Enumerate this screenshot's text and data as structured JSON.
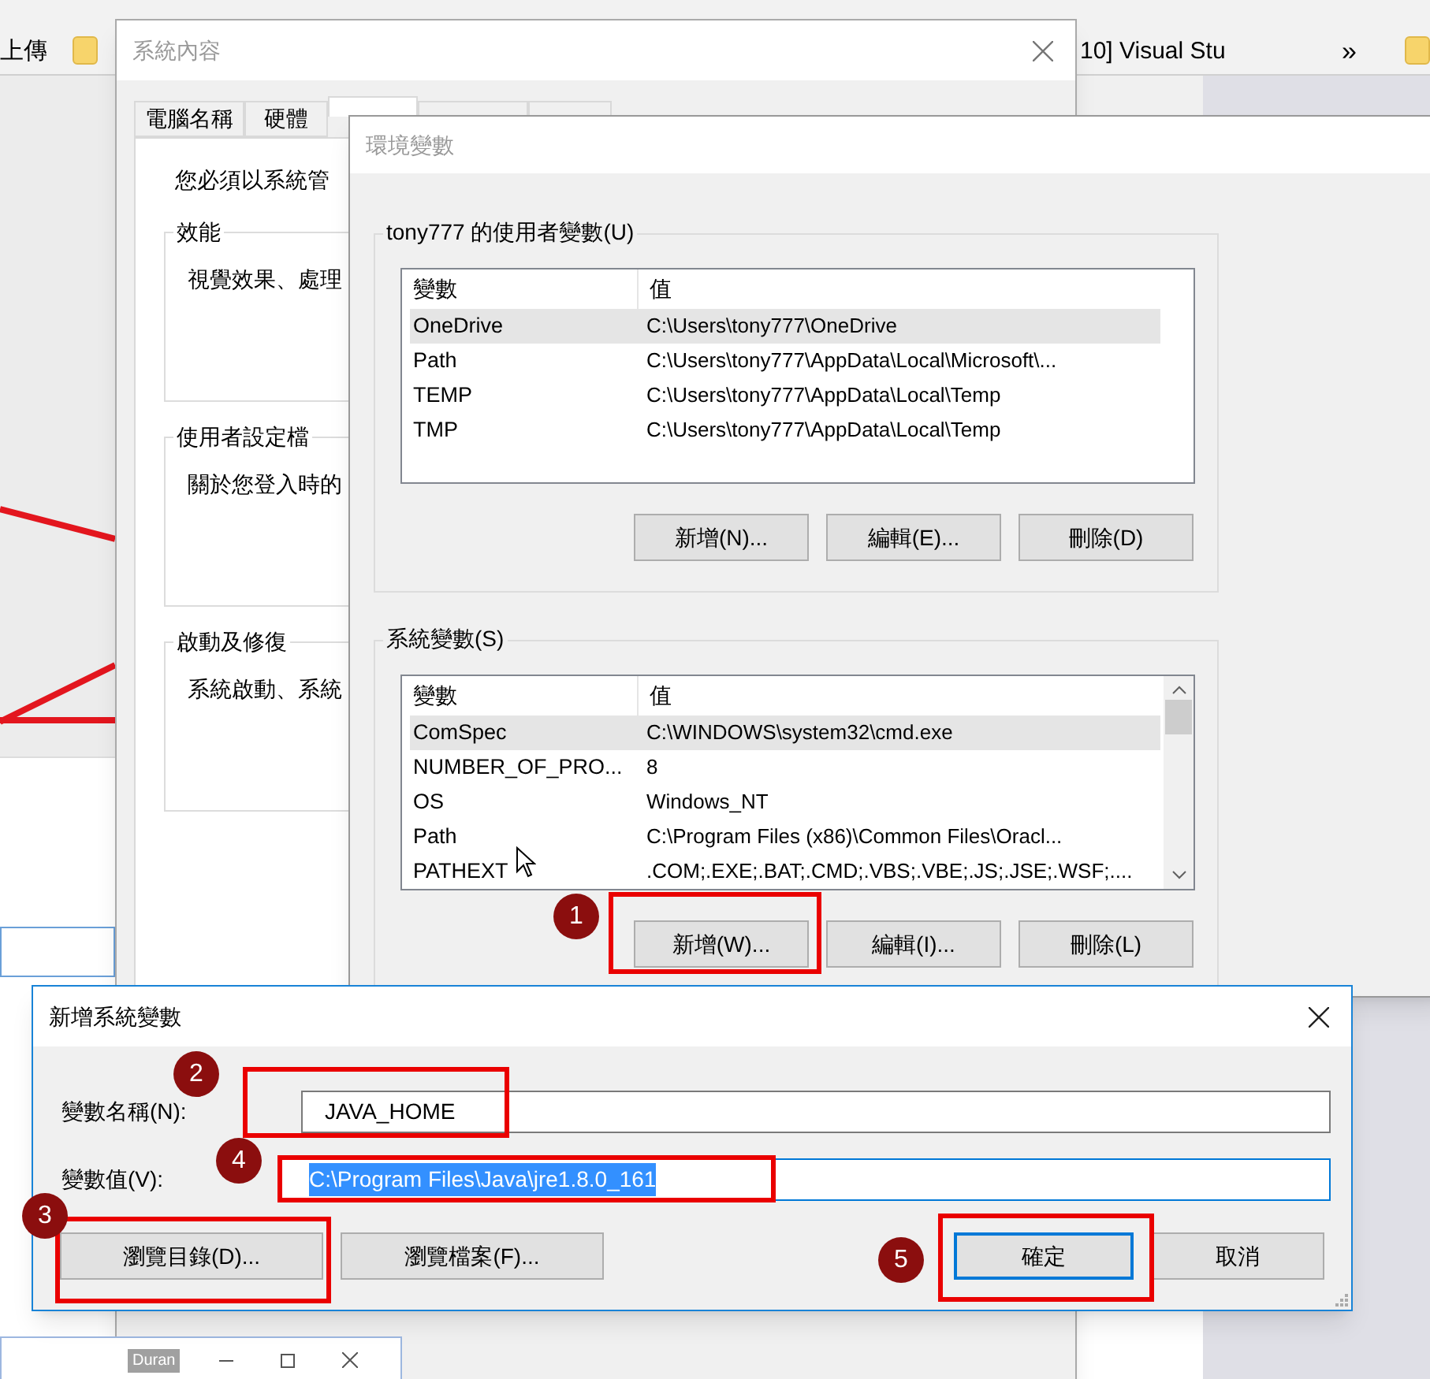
{
  "browser_bar": {
    "bookmarks": [
      {
        "label": "上傳"
      },
      {
        "label": "10] Visual Stu"
      }
    ],
    "overflow": "»"
  },
  "system_properties": {
    "title": "系統內容",
    "tabs": [
      {
        "label": "電腦名稱",
        "selected": false
      },
      {
        "label": "硬體",
        "selected": false
      },
      {
        "selected": true
      },
      {
        "selected": false
      },
      {
        "selected": false
      }
    ],
    "notice": "您必須以系統管",
    "groups": [
      {
        "title": "效能",
        "text": "視覺效果、處理"
      },
      {
        "title": "使用者設定檔",
        "text": "關於您登入時的"
      },
      {
        "title": "啟動及修復",
        "text": "系統啟動、系統"
      }
    ]
  },
  "environment_variables": {
    "title": "環境變數",
    "sections": [
      {
        "title": "tony777 的使用者變數(U)",
        "columns": [
          "變數",
          "值"
        ],
        "scrollbar": false,
        "rows": [
          {
            "name": "OneDrive",
            "value": "C:\\Users\\tony777\\OneDrive",
            "selected": true
          },
          {
            "name": "Path",
            "value": "C:\\Users\\tony777\\AppData\\Local\\Microsoft\\...",
            "selected": false
          },
          {
            "name": "TEMP",
            "value": "C:\\Users\\tony777\\AppData\\Local\\Temp",
            "selected": false
          },
          {
            "name": "TMP",
            "value": "C:\\Users\\tony777\\AppData\\Local\\Temp",
            "selected": false
          }
        ],
        "buttons": [
          "新增(N)...",
          "編輯(E)...",
          "刪除(D)"
        ]
      },
      {
        "title": "系統變數(S)",
        "columns": [
          "變數",
          "值"
        ],
        "scrollbar": true,
        "rows": [
          {
            "name": "ComSpec",
            "value": "C:\\WINDOWS\\system32\\cmd.exe",
            "selected": true
          },
          {
            "name": "NUMBER_OF_PRO...",
            "value": "8",
            "selected": false
          },
          {
            "name": "OS",
            "value": "Windows_NT",
            "selected": false
          },
          {
            "name": "Path",
            "value": "C:\\Program Files (x86)\\Common Files\\Oracl...",
            "selected": false
          },
          {
            "name": "PATHEXT",
            "value": ".COM;.EXE;.BAT;.CMD;.VBS;.VBE;.JS;.JSE;.WSF;....",
            "selected": false
          }
        ],
        "buttons": [
          "新增(W)...",
          "編輯(I)...",
          "刪除(L)"
        ]
      }
    ]
  },
  "new_variable_dialog": {
    "title": "新增系統變數",
    "fields": [
      {
        "label": "變數名稱(N):",
        "value": "JAVA_HOME",
        "text_selected": false
      },
      {
        "label": "變數值(V):",
        "value": "C:\\Program Files\\Java\\jre1.8.0_161",
        "text_selected": true
      }
    ],
    "buttons": [
      {
        "label": "瀏覽目錄(D)...",
        "default": false
      },
      {
        "label": "瀏覽檔案(F)...",
        "default": false
      },
      {
        "label": "確定",
        "default": true
      },
      {
        "label": "取消",
        "default": false
      }
    ]
  },
  "annotations": [
    {
      "label": "1"
    },
    {
      "label": "2"
    },
    {
      "label": "3"
    },
    {
      "label": "4"
    },
    {
      "label": "5"
    }
  ],
  "background_window": {
    "tag": "Duran"
  }
}
